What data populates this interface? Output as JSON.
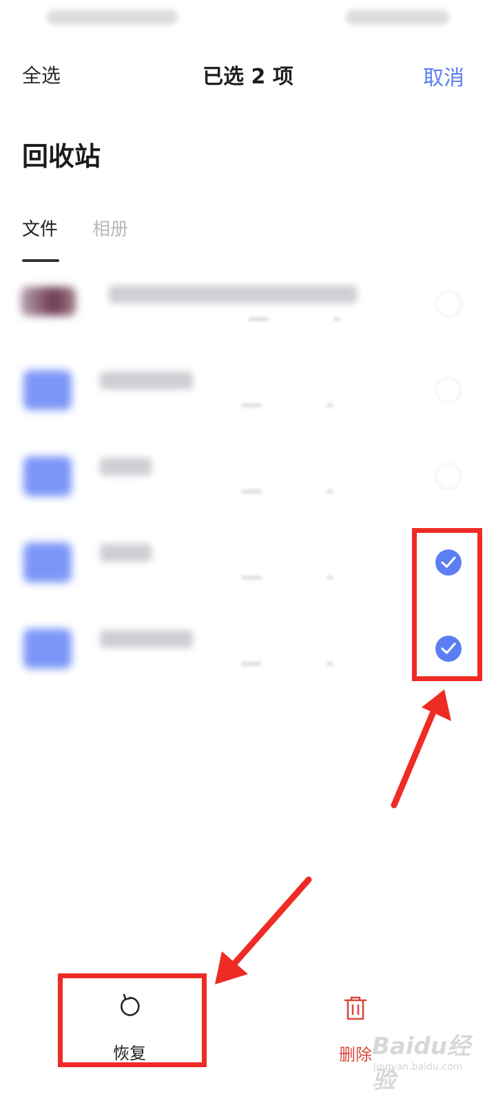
{
  "header": {
    "select_all": "全选",
    "selected_count": "已选 2 项",
    "cancel": "取消",
    "accent_color": "#5b7ff3"
  },
  "page": {
    "title": "回收站"
  },
  "tabs": [
    {
      "label": "文件",
      "active": true
    },
    {
      "label": "相册",
      "active": false
    }
  ],
  "files": [
    {
      "kind": "image",
      "icon": "image-thumbnail-icon",
      "selected": false
    },
    {
      "kind": "folder",
      "icon": "folder-icon",
      "selected": false
    },
    {
      "kind": "folder",
      "icon": "folder-icon",
      "selected": false
    },
    {
      "kind": "folder",
      "icon": "folder-icon",
      "selected": true
    },
    {
      "kind": "folder",
      "icon": "folder-icon",
      "selected": true
    }
  ],
  "bottom_bar": {
    "restore": {
      "label": "恢复",
      "icon": "restore-icon"
    },
    "delete": {
      "label": "删除",
      "icon": "trash-icon",
      "color": "#d9493e"
    }
  },
  "annotation": {
    "color": "#ee2b25"
  },
  "watermark": {
    "text": "Baidu经验",
    "url": "jingyan.baidu.com"
  }
}
